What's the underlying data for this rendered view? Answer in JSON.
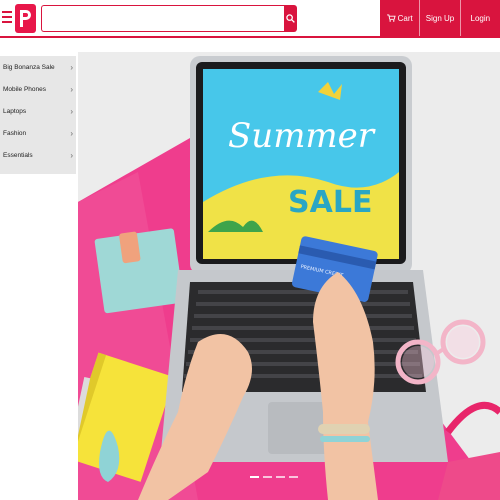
{
  "header": {
    "search_placeholder": "",
    "nav": [
      {
        "label": "Cart",
        "icon": "cart-icon"
      },
      {
        "label": "Sign Up"
      },
      {
        "label": "Login"
      }
    ],
    "brand_color": "#d9143e",
    "logo_icon": "brand-p-logo-icon",
    "menu_icon": "hamburger-menu-icon",
    "search_icon": "search-icon"
  },
  "sidebar": {
    "items": [
      {
        "label": "Big Bonanza Sale"
      },
      {
        "label": "Mobile Phones"
      },
      {
        "label": "Laptops"
      },
      {
        "label": "Fashion"
      },
      {
        "label": "Essentials"
      }
    ]
  },
  "hero": {
    "screen_title": "Summer",
    "screen_subtitle": "SALE",
    "card_text": "PREMIUM CREDIT",
    "slide_count": 4,
    "active_slide": 1
  }
}
